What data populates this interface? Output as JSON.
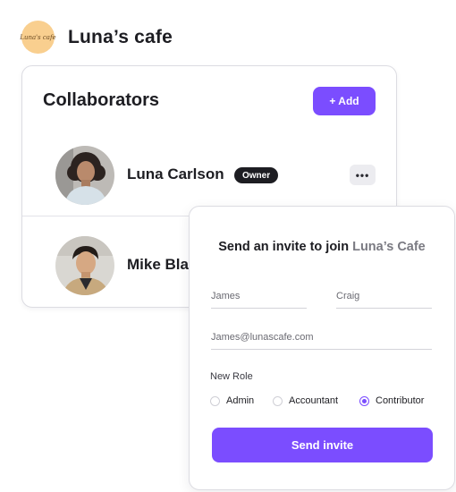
{
  "brand": {
    "logo_text": "Luna's cafe",
    "name": "Luna’s cafe"
  },
  "collaborators": {
    "title": "Collaborators",
    "add_label": "+ Add",
    "members": [
      {
        "name": "Luna Carlson",
        "badge": "Owner",
        "more_label": "•••"
      },
      {
        "name": "Mike Bla"
      }
    ]
  },
  "invite": {
    "title_prefix": "Send an invite to join ",
    "title_highlight": "Luna’s Cafe",
    "first_name_placeholder": "James",
    "last_name_placeholder": "Craig",
    "email_placeholder": "James@lunascafe.com",
    "role_label": "New Role",
    "roles": [
      {
        "label": "Admin",
        "selected": false
      },
      {
        "label": "Accountant",
        "selected": false
      },
      {
        "label": "Contributor",
        "selected": true
      }
    ],
    "send_label": "Send invite"
  },
  "colors": {
    "accent": "#7b4dff",
    "logo_bg": "#f9cf8f",
    "badge_bg": "#1d1d22"
  }
}
